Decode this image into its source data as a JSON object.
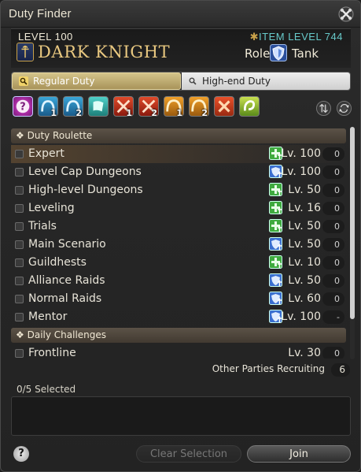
{
  "window": {
    "title": "Duty Finder"
  },
  "job": {
    "level": "LEVEL 100",
    "name": "DARK KNIGHT",
    "item_level": "ITEM LEVEL 744",
    "role_label": "Role:",
    "role_name": "Tank"
  },
  "tabs": [
    {
      "label": "Regular Duty",
      "selected": true
    },
    {
      "label": "High-end Duty",
      "selected": false
    }
  ],
  "duty_icons": [
    {
      "name": "roulette-icon",
      "number": ""
    },
    {
      "name": "dungeon-icon",
      "number": "1"
    },
    {
      "name": "dungeon-icon",
      "number": "2"
    },
    {
      "name": "guildhest-icon",
      "number": ""
    },
    {
      "name": "trial-icon",
      "number": "1"
    },
    {
      "name": "trial-icon",
      "number": "2"
    },
    {
      "name": "raid-icon",
      "number": "1"
    },
    {
      "name": "raid-icon",
      "number": "2"
    },
    {
      "name": "pvp-icon",
      "number": ""
    },
    {
      "name": "gold-saucer-icon",
      "number": ""
    }
  ],
  "sections": {
    "roulette_header": "Duty Roulette",
    "daily_header": "Daily Challenges"
  },
  "roulettes": [
    {
      "name": "Expert",
      "role": "green",
      "level": "Lv. 100",
      "count": "0"
    },
    {
      "name": "Level Cap Dungeons",
      "role": "blue",
      "level": "Lv. 100",
      "count": "0"
    },
    {
      "name": "High-level Dungeons",
      "role": "green",
      "level": "Lv. 50",
      "count": "0"
    },
    {
      "name": "Leveling",
      "role": "green",
      "level": "Lv. 16",
      "count": "0"
    },
    {
      "name": "Trials",
      "role": "green",
      "level": "Lv. 50",
      "count": "0"
    },
    {
      "name": "Main Scenario",
      "role": "blue",
      "level": "Lv. 50",
      "count": "0"
    },
    {
      "name": "Guildhests",
      "role": "green",
      "level": "Lv. 10",
      "count": "0"
    },
    {
      "name": "Alliance Raids",
      "role": "blue",
      "level": "Lv. 50",
      "count": "0"
    },
    {
      "name": "Normal Raids",
      "role": "blue",
      "level": "Lv. 60",
      "count": "0"
    },
    {
      "name": "Mentor",
      "role": "blue",
      "level": "Lv. 100",
      "count": "-"
    }
  ],
  "daily": [
    {
      "name": "Frontline",
      "role": "",
      "level": "Lv. 30",
      "count": "0"
    }
  ],
  "footer": {
    "recruiting_label": "Other Parties Recruiting",
    "recruiting_count": "6",
    "selected_text": "0/5 Selected",
    "help": "?",
    "clear_button": "Clear Selection",
    "join_button": "Join"
  },
  "colors": {
    "job_name": "#e9c880",
    "item_level": "#67c9c9",
    "tab_selected": "#d4c48a",
    "bonus_green": "#3faa3f",
    "bonus_blue": "#3a6fd0"
  }
}
